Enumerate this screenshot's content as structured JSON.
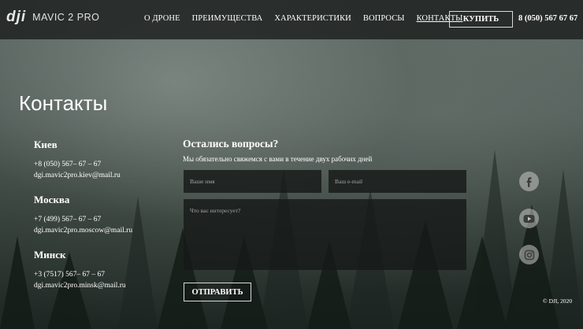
{
  "header": {
    "logo": "dji",
    "model": "MAVIC 2 PRO",
    "nav": [
      "О ДРОНЕ",
      "ПРЕИМУЩЕСТВА",
      "ХАРАКТЕРИСТИКИ",
      "ВОПРОСЫ",
      "КОНТАКТЫ"
    ],
    "buy_label": "КУПИТЬ",
    "phone": "8 (050) 567 67 67"
  },
  "page_title": "Контакты",
  "cities": [
    {
      "name": "Киев",
      "phone": "+8 (050) 567– 67 – 67",
      "email": "dgi.mavic2pro.kiev@mail.ru"
    },
    {
      "name": "Москва",
      "phone": "+7 (499) 567– 67 – 67",
      "email": "dgi.mavic2pro.moscow@mail.ru"
    },
    {
      "name": "Минск",
      "phone": "+3 (7517) 567– 67 – 67",
      "email": "dgi.mavic2pro.minsk@mail.ru"
    }
  ],
  "form": {
    "title": "Остались вопросы?",
    "subtitle": "Мы обязательно свяжемся с вами в течение двух рабочих дней",
    "name_placeholder": "Ваше имя",
    "email_placeholder": "Ваш e-mail",
    "message_placeholder": "Что вас интересует?",
    "submit_label": "ОТПРАВИТЬ"
  },
  "socials": [
    "facebook-icon",
    "youtube-icon",
    "instagram-icon"
  ],
  "copyright": "© DJI, 2020",
  "colors": {
    "header_bg": "#1c201f",
    "text": "#ffffff",
    "field_bg": "#161a18"
  }
}
